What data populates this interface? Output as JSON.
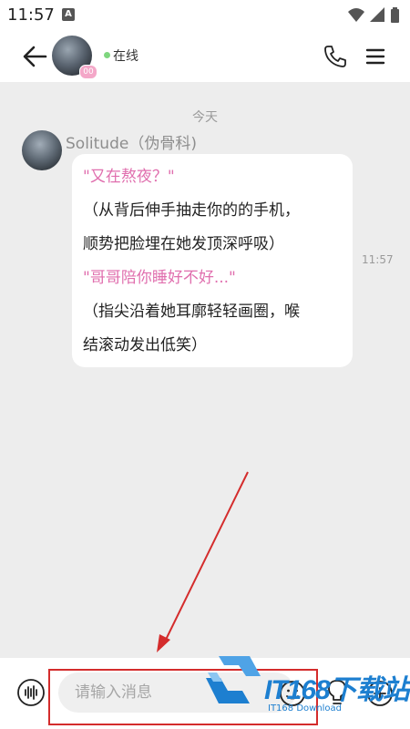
{
  "status_bar": {
    "time": "11:57",
    "notification_letter": "A"
  },
  "header": {
    "avatar_badge": "00",
    "status_text": "在线"
  },
  "chat": {
    "date_separator": "今天",
    "message": {
      "sender": "Solitude（伪骨科)",
      "time": "11:57",
      "lines": [
        {
          "text": "\"又在熬夜？\""
        },
        {
          "text": "（从背后伸手抽走你的的手机，"
        },
        {
          "text": "顺势把脸埋在她发顶深呼吸）"
        },
        {
          "text": "\"哥哥陪你睡好不好...\""
        },
        {
          "text": "（指尖沿着她耳廓轻轻画圈，喉"
        },
        {
          "text": "结滚动发出低笑）"
        }
      ]
    }
  },
  "input_bar": {
    "placeholder": "请输入消息",
    "value": ""
  },
  "watermark": {
    "main": "IT168下载站",
    "sub": "IT168 Download"
  },
  "colors": {
    "highlight_text": "#e06fae",
    "online_dot": "#7fd67f",
    "annotation_red": "#d42c2c",
    "watermark_blue": "#1d7fd0"
  },
  "icons": {
    "back": "arrow-left-icon",
    "phone": "phone-icon",
    "menu": "menu-icon",
    "voice": "voice-wave-icon",
    "emoji": "emoji-icon",
    "bulb": "lightbulb-icon",
    "plus": "plus-circle-icon"
  }
}
